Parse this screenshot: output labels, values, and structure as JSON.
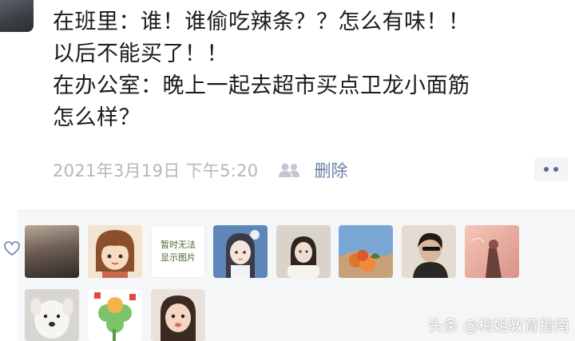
{
  "post": {
    "lines": [
      "在班里：谁！谁偷吃辣条？？怎么有味！！",
      "以后不能买了！！",
      "在办公室：晚上一起去超市买点卫龙小面筋",
      "怎么样？"
    ],
    "timestamp": "2021年3月19日 下午5:20",
    "delete_label": "删除"
  },
  "likes": {
    "count_visible": 11,
    "text_avatar": [
      "暂时无法",
      "显示图片"
    ]
  },
  "watermark": "头条 @梅姐教育指南",
  "colors": {
    "link": "#6c7fa6",
    "timestamp": "#b7b7b7",
    "panel": "#f5f6f8"
  }
}
